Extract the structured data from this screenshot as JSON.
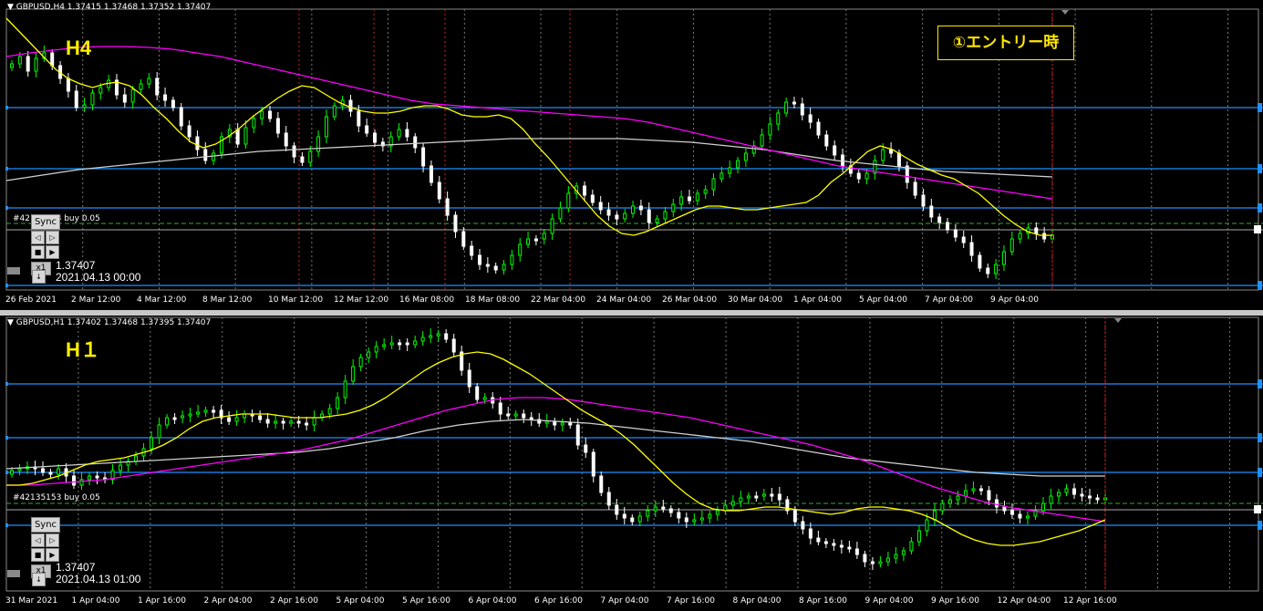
{
  "colors": {
    "bull": "#00ff00",
    "bear": "#ffffff",
    "ma_fast": "#ffff00",
    "ma_mid": "#ff00ff",
    "ma_slow": "#d0d0d0",
    "hline": "#1e90ff",
    "grid": "#777777",
    "order": "#33aa33",
    "separator": "#cc2222"
  },
  "top": {
    "header": "▼ GBPUSD,H4  1.37415 1.37468 1.37352 1.37407",
    "label": "H4",
    "entry_box": "①エントリー時",
    "order_label": "#42135153 buy 0.05",
    "sync": "Sync",
    "x1": "x1",
    "price_readout": "1.37407",
    "date_readout": "2021.04.13 00:00",
    "xaxis_labels": [
      "26 Feb 2021",
      "2 Mar 12:00",
      "4 Mar 12:00",
      "8 Mar 12:00",
      "10 Mar 12:00",
      "12 Mar 12:00",
      "16 Mar 08:00",
      "18 Mar 08:00",
      "22 Mar 04:00",
      "24 Mar 04:00",
      "26 Mar 04:00",
      "30 Mar 04:00",
      "1 Apr 04:00",
      "5 Apr 04:00",
      "7 Apr 04:00",
      "9 Apr 04:00"
    ]
  },
  "bottom": {
    "header": "▼ GBPUSD,H1  1.37402 1.37468 1.37395 1.37407",
    "label": "H１",
    "order_label": "#42135153 buy 0.05",
    "sync": "Sync",
    "x1": "x1",
    "price_readout": "1.37407",
    "date_readout": "2021.04.13 01:00",
    "xaxis_labels": [
      "31 Mar 2021",
      "1 Apr 04:00",
      "1 Apr 16:00",
      "2 Apr 04:00",
      "2 Apr 16:00",
      "5 Apr 04:00",
      "5 Apr 16:00",
      "6 Apr 04:00",
      "6 Apr 16:00",
      "7 Apr 04:00",
      "7 Apr 16:00",
      "8 Apr 04:00",
      "8 Apr 16:00",
      "9 Apr 04:00",
      "9 Apr 16:00",
      "12 Apr 04:00",
      "12 Apr 16:00"
    ]
  },
  "chart_data": [
    {
      "type": "candlestick",
      "symbol": "GBPUSD",
      "timeframe": "H4",
      "ohlc_last": {
        "open": 1.37415,
        "high": 1.37468,
        "low": 1.37352,
        "close": 1.37407
      },
      "x": [
        "26 Feb 2021",
        "2 Mar 12:00",
        "4 Mar 12:00",
        "8 Mar 12:00",
        "10 Mar 12:00",
        "12 Mar 12:00",
        "16 Mar 08:00",
        "18 Mar 08:00",
        "22 Mar 04:00",
        "24 Mar 04:00",
        "26 Mar 04:00",
        "30 Mar 04:00",
        "1 Apr 04:00",
        "5 Apr 04:00",
        "7 Apr 04:00",
        "9 Apr 04:00"
      ],
      "close_series": [
        70,
        62,
        78,
        64,
        58,
        72,
        86,
        100,
        118,
        115,
        102,
        96,
        88,
        104,
        112,
        98,
        92,
        86,
        104,
        110,
        118,
        138,
        150,
        164,
        176,
        168,
        150,
        142,
        158,
        140,
        130,
        122,
        130,
        146,
        160,
        172,
        178,
        166,
        150,
        128,
        116,
        110,
        122,
        138,
        146,
        156,
        160,
        150,
        142,
        150,
        162,
        182,
        200,
        218,
        236,
        254,
        270,
        280,
        290,
        292,
        296,
        290,
        280,
        268,
        262,
        262,
        256,
        240,
        228,
        212,
        204,
        214,
        222,
        230,
        236,
        240,
        234,
        226,
        230,
        244,
        240,
        232,
        224,
        216,
        220,
        212,
        208,
        196,
        190,
        184,
        176,
        168,
        160,
        148,
        136,
        124,
        112,
        114,
        126,
        134,
        148,
        160,
        170,
        182,
        190,
        196,
        190,
        176,
        164,
        168,
        182,
        200,
        214,
        226,
        238,
        244,
        252,
        260,
        266,
        280,
        294,
        300,
        290,
        276,
        262,
        256,
        250,
        256,
        262,
        258
      ],
      "ma_fast": [
        20,
        34,
        48,
        62,
        76,
        86,
        92,
        96,
        92,
        90,
        94,
        104,
        118,
        130,
        144,
        156,
        162,
        158,
        150,
        140,
        128,
        118,
        108,
        100,
        94,
        96,
        104,
        112,
        118,
        122,
        124,
        124,
        122,
        118,
        116,
        116,
        120,
        126,
        128,
        128,
        126,
        130,
        142,
        158,
        172,
        188,
        204,
        220,
        236,
        248,
        256,
        258,
        254,
        248,
        242,
        236,
        230,
        226,
        226,
        228,
        230,
        230,
        228,
        226,
        224,
        222,
        214,
        200,
        190,
        178,
        166,
        160,
        164,
        172,
        180,
        186,
        192,
        196,
        204,
        212,
        224,
        236,
        246,
        254,
        258,
        258
      ],
      "ma_mid": [
        62,
        58,
        55,
        52,
        51,
        51,
        52,
        54,
        58,
        62,
        68,
        74,
        80,
        86,
        92,
        98,
        104,
        110,
        114,
        116,
        118,
        120,
        122,
        124,
        126,
        128,
        130,
        134,
        140,
        146,
        152,
        158,
        164,
        170,
        176,
        182,
        186,
        190,
        194,
        198,
        202,
        206,
        210,
        214,
        218
      ],
      "ma_slow": [
        198,
        192,
        186,
        182,
        178,
        174,
        170,
        166,
        164,
        162,
        160,
        158,
        156,
        154,
        152,
        152,
        152,
        152,
        154,
        156,
        160,
        164,
        170,
        176,
        180,
        184,
        188,
        190,
        192,
        194
      ],
      "levels": [
        118,
        185,
        228,
        313
      ],
      "order_level": 245,
      "separators_x": [
        328,
        410,
        488,
        625,
        1154
      ]
    },
    {
      "type": "candlestick",
      "symbol": "GBPUSD",
      "timeframe": "H1",
      "ohlc_last": {
        "open": 1.37402,
        "high": 1.37468,
        "low": 1.37395,
        "close": 1.37407
      },
      "x": [
        "31 Mar 2021",
        "1 Apr 04:00",
        "1 Apr 16:00",
        "2 Apr 04:00",
        "2 Apr 16:00",
        "5 Apr 04:00",
        "5 Apr 16:00",
        "6 Apr 04:00",
        "6 Apr 16:00",
        "7 Apr 04:00",
        "7 Apr 16:00",
        "8 Apr 04:00",
        "8 Apr 16:00",
        "9 Apr 04:00",
        "9 Apr 16:00",
        "12 Apr 04:00",
        "12 Apr 16:00"
      ],
      "close_series": [
        170,
        168,
        166,
        168,
        172,
        174,
        168,
        176,
        186,
        180,
        176,
        178,
        180,
        170,
        164,
        160,
        154,
        146,
        134,
        120,
        112,
        112,
        110,
        108,
        106,
        104,
        104,
        112,
        116,
        112,
        108,
        110,
        114,
        118,
        116,
        118,
        116,
        118,
        120,
        112,
        108,
        102,
        90,
        72,
        56,
        46,
        40,
        34,
        32,
        30,
        30,
        32,
        28,
        24,
        22,
        20,
        26,
        40,
        60,
        78,
        92,
        90,
        96,
        108,
        110,
        108,
        112,
        114,
        118,
        116,
        120,
        118,
        120,
        142,
        150,
        176,
        194,
        208,
        218,
        222,
        226,
        220,
        214,
        210,
        212,
        216,
        222,
        226,
        224,
        222,
        218,
        214,
        208,
        204,
        200,
        198,
        198,
        196,
        196,
        202,
        214,
        226,
        234,
        244,
        248,
        250,
        252,
        254,
        256,
        262,
        270,
        272,
        270,
        266,
        262,
        258,
        248,
        236,
        224,
        214,
        206,
        202,
        198,
        192,
        190,
        192,
        202,
        210,
        214,
        218,
        222,
        220,
        214,
        206,
        198,
        194,
        190,
        196,
        198,
        200,
        202,
        200
      ],
      "ma_fast": [
        186,
        186,
        184,
        180,
        176,
        170,
        164,
        160,
        158,
        156,
        152,
        148,
        142,
        134,
        124,
        116,
        112,
        110,
        108,
        108,
        108,
        110,
        112,
        112,
        112,
        110,
        108,
        104,
        98,
        90,
        80,
        70,
        60,
        52,
        46,
        42,
        40,
        42,
        48,
        56,
        64,
        74,
        84,
        94,
        104,
        112,
        120,
        130,
        142,
        156,
        170,
        184,
        196,
        206,
        212,
        214,
        214,
        212,
        210,
        210,
        212,
        214,
        216,
        218,
        216,
        212,
        210,
        210,
        212,
        214,
        218,
        224,
        232,
        240,
        246,
        250,
        252,
        252,
        250,
        248,
        244,
        240,
        236,
        230,
        224
      ],
      "ma_mid": [
        186,
        186,
        184,
        182,
        180,
        176,
        172,
        168,
        164,
        160,
        156,
        152,
        148,
        142,
        136,
        128,
        120,
        112,
        104,
        98,
        92,
        90,
        90,
        92,
        96,
        100,
        104,
        108,
        112,
        118,
        124,
        130,
        136,
        142,
        150,
        158,
        168,
        178,
        188,
        196,
        204,
        210,
        214,
        218,
        222,
        226
      ],
      "ma_slow": [
        168,
        166,
        164,
        162,
        160,
        158,
        156,
        154,
        152,
        150,
        146,
        140,
        134,
        126,
        120,
        116,
        114,
        116,
        118,
        122,
        126,
        130,
        134,
        138,
        144,
        150,
        156,
        160,
        164,
        168,
        172,
        174,
        176,
        176,
        176
      ],
      "levels": [
        421,
        480,
        518,
        576
      ],
      "order_level": 552,
      "separators_x": [
        1212
      ]
    }
  ]
}
